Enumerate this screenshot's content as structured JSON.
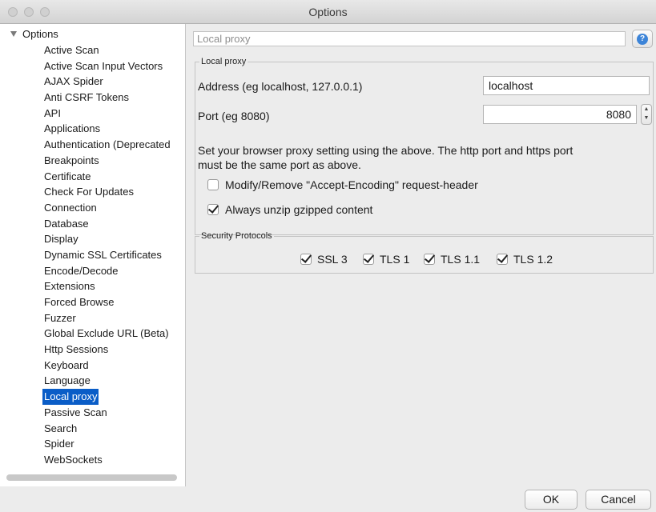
{
  "window": {
    "title": "Options"
  },
  "sidebar": {
    "root_label": "Options",
    "items": [
      {
        "label": "Active Scan"
      },
      {
        "label": "Active Scan Input Vectors"
      },
      {
        "label": "AJAX Spider"
      },
      {
        "label": "Anti CSRF Tokens"
      },
      {
        "label": "API"
      },
      {
        "label": "Applications"
      },
      {
        "label": "Authentication (Deprecated"
      },
      {
        "label": "Breakpoints"
      },
      {
        "label": "Certificate"
      },
      {
        "label": "Check For Updates"
      },
      {
        "label": "Connection"
      },
      {
        "label": "Database"
      },
      {
        "label": "Display"
      },
      {
        "label": "Dynamic SSL Certificates"
      },
      {
        "label": "Encode/Decode"
      },
      {
        "label": "Extensions"
      },
      {
        "label": "Forced Browse"
      },
      {
        "label": "Fuzzer"
      },
      {
        "label": "Global Exclude URL (Beta)"
      },
      {
        "label": "Http Sessions"
      },
      {
        "label": "Keyboard"
      },
      {
        "label": "Language"
      },
      {
        "label": "Local proxy",
        "selected": true
      },
      {
        "label": "Passive Scan"
      },
      {
        "label": "Search"
      },
      {
        "label": "Spider"
      },
      {
        "label": "WebSockets"
      }
    ]
  },
  "main": {
    "header_title": "Local proxy",
    "help_icon": "question-icon",
    "local_proxy": {
      "legend": "Local proxy",
      "address_label": "Address (eg localhost, 127.0.0.1)",
      "address_value": "localhost",
      "port_label": "Port (eg 8080)",
      "port_value": "8080",
      "note_line1": "Set your browser proxy setting using the above. The http port and https port",
      "note_line2": "must be the same port as above.",
      "modify_accept_encoding": {
        "label": "Modify/Remove \"Accept-Encoding\" request-header",
        "checked": false
      },
      "unzip_gzip": {
        "label": "Always unzip gzipped content",
        "checked": true
      }
    },
    "security_protocols": {
      "legend": "Security Protocols",
      "items": [
        {
          "label": "SSL 3",
          "checked": true
        },
        {
          "label": "TLS 1",
          "checked": true
        },
        {
          "label": "TLS 1.1",
          "checked": true
        },
        {
          "label": "TLS 1.2",
          "checked": true
        }
      ]
    }
  },
  "footer": {
    "ok_label": "OK",
    "cancel_label": "Cancel"
  }
}
